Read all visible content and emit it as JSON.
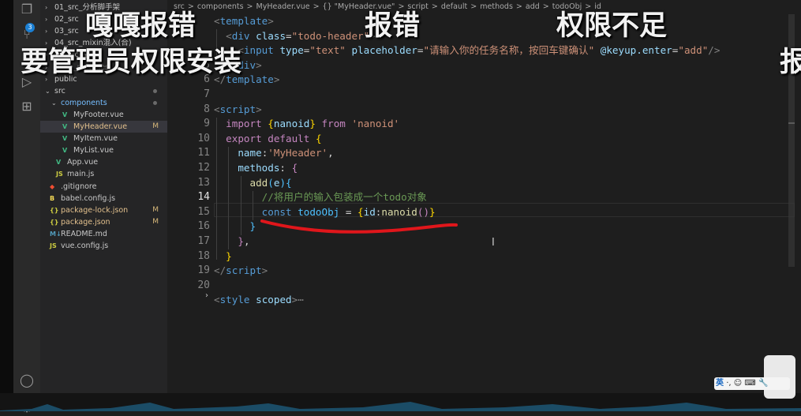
{
  "overlay": {
    "t1": "嘎嘎报错",
    "t2": "报错",
    "t3": "权限不足",
    "t4": "要管理员权限安装",
    "t5": "报"
  },
  "activity": {
    "badge": "3"
  },
  "explorer": {
    "items": [
      {
        "label": "01_src_分析脚手架",
        "indent": 1,
        "type": "folder",
        "chev": "›"
      },
      {
        "label": "02_src",
        "indent": 1,
        "type": "folder",
        "chev": "›"
      },
      {
        "label": "03_src",
        "indent": 1,
        "type": "folder",
        "chev": "›"
      },
      {
        "label": "04_src_mixin混入(合)",
        "indent": 1,
        "type": "folder",
        "chev": "›"
      },
      {
        "label": "05_src_插件",
        "indent": 1,
        "type": "folder",
        "chev": "›"
      },
      {
        "label": "node_modules",
        "indent": 1,
        "type": "folder",
        "chev": "›",
        "dim": true
      },
      {
        "label": "public",
        "indent": 1,
        "type": "folder",
        "chev": "›"
      },
      {
        "label": "src",
        "indent": 1,
        "type": "folder",
        "chev": "⌄",
        "dot": true
      },
      {
        "label": "components",
        "indent": 2,
        "type": "folder",
        "chev": "⌄",
        "dot": true,
        "color": "#75beff"
      },
      {
        "label": "MyFooter.vue",
        "indent": 3,
        "type": "vue"
      },
      {
        "label": "MyHeader.vue",
        "indent": 3,
        "type": "vue",
        "status": "M",
        "selected": true,
        "color": "#e2c08d"
      },
      {
        "label": "MyItem.vue",
        "indent": 3,
        "type": "vue"
      },
      {
        "label": "MyList.vue",
        "indent": 3,
        "type": "vue"
      },
      {
        "label": "App.vue",
        "indent": 2,
        "type": "vue"
      },
      {
        "label": "main.js",
        "indent": 2,
        "type": "js"
      },
      {
        "label": ".gitignore",
        "indent": 1,
        "type": "git"
      },
      {
        "label": "babel.config.js",
        "indent": 1,
        "type": "babel"
      },
      {
        "label": "package-lock.json",
        "indent": 1,
        "type": "json",
        "status": "M",
        "color": "#e2c08d"
      },
      {
        "label": "package.json",
        "indent": 1,
        "type": "json",
        "status": "M",
        "color": "#e2c08d"
      },
      {
        "label": "README.md",
        "indent": 1,
        "type": "md"
      },
      {
        "label": "vue.config.js",
        "indent": 1,
        "type": "js"
      }
    ]
  },
  "breadcrumb": [
    "src",
    ">",
    "components",
    ">",
    "MyHeader.vue",
    ">",
    "{} \"MyHeader.vue\"",
    ">",
    "script",
    ">",
    "default",
    ">",
    "methods",
    ">",
    "add",
    ">",
    "todoObj",
    ">",
    "id"
  ],
  "editor": {
    "line_numbers": [
      "",
      "",
      "",
      "5",
      "6",
      "7",
      "8",
      "9",
      "10",
      "11",
      "12",
      "13",
      "14",
      "15",
      "16",
      "17",
      "18",
      "19",
      "20"
    ],
    "current_line": "14",
    "comment": "//将用户的输入包装成一个todo对象",
    "placeholder_text": "请输入你的任务名称，按回车键确认",
    "fold_marker": "⋯"
  },
  "ime": {
    "label": "英",
    "extra": "·, ☺ ⌨ 🔧"
  },
  "colors": {
    "underline": "#e0161b",
    "accent": "#1b80d4"
  }
}
